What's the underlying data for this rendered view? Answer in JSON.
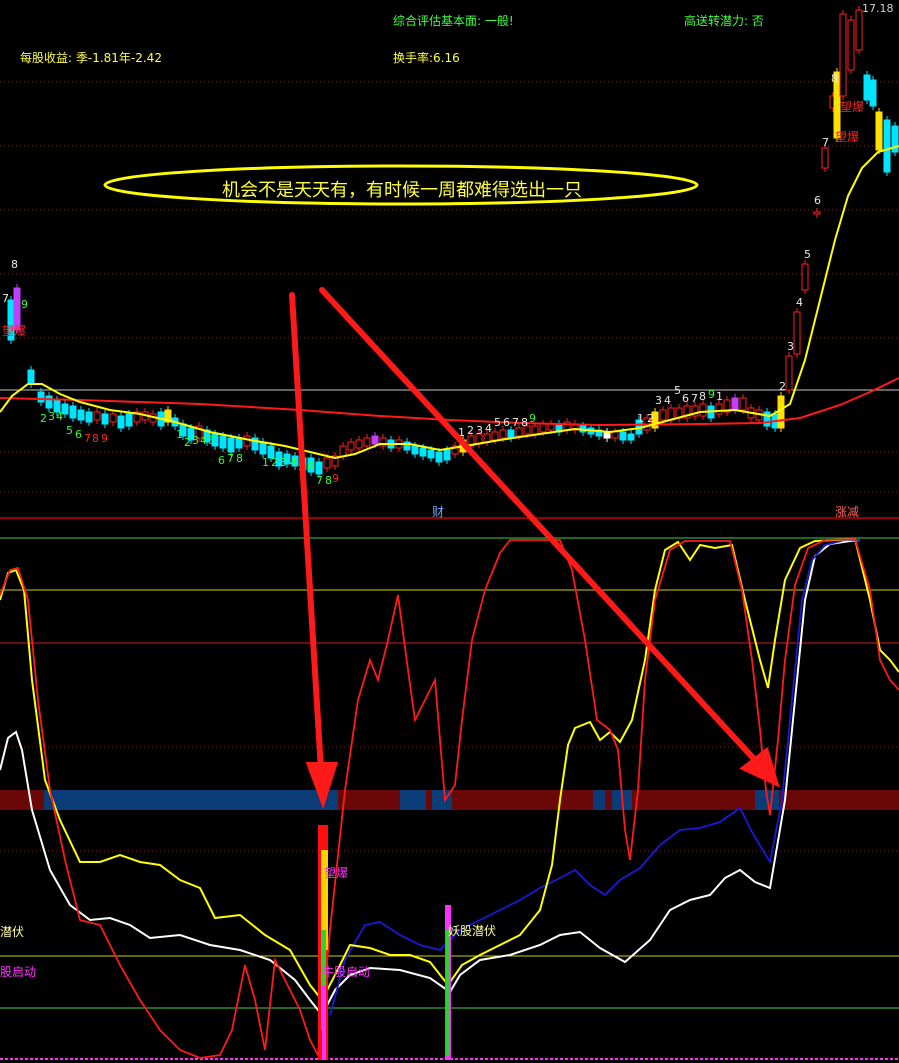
{
  "header": {
    "eps": "每股收益: 季-1.81年-2.42",
    "rating": "综合评估基本面: 一般!",
    "turnover": "换手率:6.16",
    "transfer": "高送转潜力: 否",
    "price_high": "17.18"
  },
  "caption": "机会不是天天有，有时候一周都难得选出一只",
  "labels": {
    "cai": "财",
    "zhangjian": "涨减",
    "wangbao1": "望爆",
    "wangbao2": "望爆",
    "wangbao_left": "望爆",
    "ind_wangbao": "望爆",
    "qianfu_left": "潜伏",
    "qidong_left": "股启动",
    "qidong_mid": "牛股启动",
    "yaogu": "妖股潜伏"
  },
  "colors": {
    "background": "#000000",
    "yellow": "#ffff00",
    "red": "#ff2020",
    "cyan": "#00ffff",
    "white": "#ffffff",
    "blue": "#1010c0",
    "magenta": "#ff30ff",
    "green": "#30ff30"
  },
  "chart_data": {
    "type": "candlestick",
    "count_labels": [
      {
        "text": "8",
        "color": "white"
      },
      {
        "text": "7",
        "color": "white"
      },
      {
        "text": "9",
        "color": "green"
      },
      {
        "text": "2",
        "color": "green"
      },
      {
        "text": "3",
        "color": "green"
      },
      {
        "text": "4",
        "color": "green"
      },
      {
        "text": "5",
        "color": "green"
      },
      {
        "text": "6",
        "color": "green"
      },
      {
        "text": "7",
        "color": "red"
      },
      {
        "text": "8",
        "color": "red"
      },
      {
        "text": "9",
        "color": "red"
      },
      {
        "text": "1",
        "color": "green"
      },
      {
        "text": "2",
        "color": "green"
      },
      {
        "text": "3",
        "color": "green"
      },
      {
        "text": "4",
        "color": "green"
      },
      {
        "text": "5",
        "color": "green"
      },
      {
        "text": "6",
        "color": "green"
      },
      {
        "text": "7",
        "color": "green"
      },
      {
        "text": "8",
        "color": "green"
      },
      {
        "text": "1",
        "color": "green"
      },
      {
        "text": "2",
        "color": "green"
      },
      {
        "text": "3",
        "color": "green"
      },
      {
        "text": "4",
        "color": "green"
      },
      {
        "text": "5",
        "color": "green"
      },
      {
        "text": "6",
        "color": "green"
      },
      {
        "text": "7",
        "color": "green"
      },
      {
        "text": "8",
        "color": "green"
      },
      {
        "text": "9",
        "color": "red"
      },
      {
        "text": "1",
        "color": "white"
      },
      {
        "text": "2",
        "color": "white"
      },
      {
        "text": "3",
        "color": "white"
      },
      {
        "text": "4",
        "color": "white"
      },
      {
        "text": "5",
        "color": "white"
      },
      {
        "text": "6",
        "color": "white"
      },
      {
        "text": "7",
        "color": "white"
      },
      {
        "text": "8",
        "color": "white"
      },
      {
        "text": "9",
        "color": "green"
      },
      {
        "text": "1",
        "color": "white"
      },
      {
        "text": "2",
        "color": "white"
      },
      {
        "text": "3",
        "color": "white"
      },
      {
        "text": "4",
        "color": "white"
      },
      {
        "text": "5",
        "color": "white"
      },
      {
        "text": "6",
        "color": "white"
      },
      {
        "text": "7",
        "color": "white"
      },
      {
        "text": "8",
        "color": "white"
      },
      {
        "text": "9",
        "color": "green"
      },
      {
        "text": "1",
        "color": "white"
      },
      {
        "text": "2",
        "color": "white"
      },
      {
        "text": "3",
        "color": "white"
      },
      {
        "text": "4",
        "color": "white"
      },
      {
        "text": "5",
        "color": "white"
      },
      {
        "text": "6",
        "color": "white"
      },
      {
        "text": "7",
        "color": "white"
      },
      {
        "text": "8",
        "color": "white"
      }
    ]
  }
}
